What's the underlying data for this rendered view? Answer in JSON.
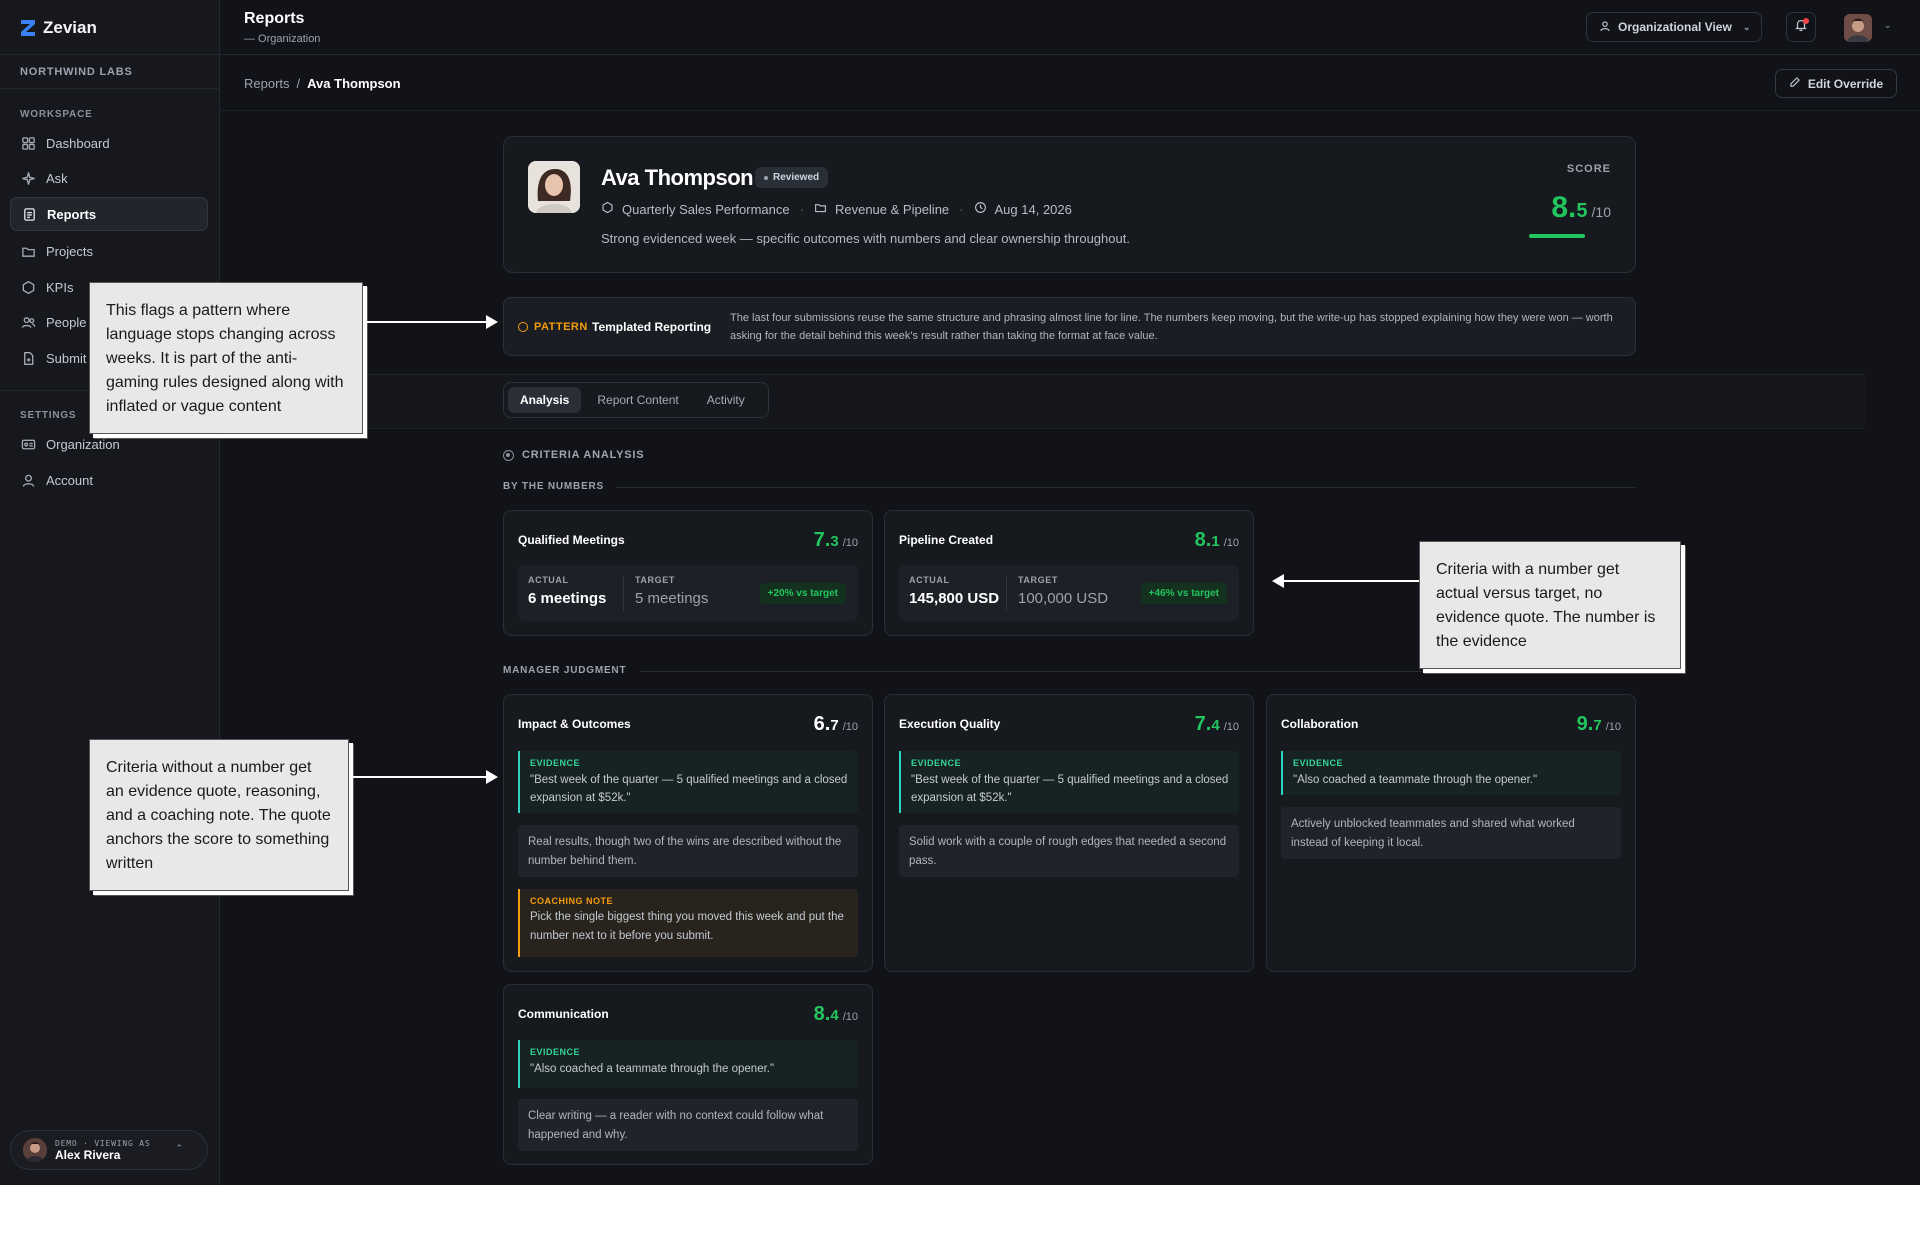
{
  "app": {
    "name": "Zevian",
    "org": "NORTHWIND LABS"
  },
  "sidebar": {
    "workspace_label": "WORKSPACE",
    "settings_label": "SETTINGS",
    "items": [
      {
        "label": "Dashboard",
        "icon": "grid-icon"
      },
      {
        "label": "Ask",
        "icon": "sparkle-icon"
      },
      {
        "label": "Reports",
        "icon": "report-icon"
      },
      {
        "label": "Projects",
        "icon": "folder-icon"
      },
      {
        "label": "KPIs",
        "icon": "hexagon-icon"
      },
      {
        "label": "People",
        "icon": "people-icon"
      },
      {
        "label": "Submit",
        "icon": "file-plus-icon"
      }
    ],
    "settings_items": [
      {
        "label": "Organization",
        "icon": "id-card-icon"
      },
      {
        "label": "Account",
        "icon": "user-icon"
      }
    ],
    "demo": {
      "label": "DEMO · VIEWING AS",
      "name": "Alex Rivera"
    }
  },
  "header": {
    "title": "Reports",
    "subtitle": "— Organization",
    "view_select": "Organizational View"
  },
  "breadcrumb": {
    "root": "Reports",
    "separator": "/",
    "current": "Ava Thompson",
    "edit_label": "Edit Override"
  },
  "profile": {
    "name": "Ava Thompson",
    "badge": "Reviewed",
    "kpi": "Quarterly Sales Performance",
    "project": "Revenue & Pipeline",
    "date": "Aug 14, 2026",
    "summary": "Strong evidenced week — specific outcomes with numbers and clear ownership throughout.",
    "score_label": "SCORE",
    "score_int": "8.",
    "score_dec": "5",
    "score_den": "/10",
    "score_value": 8.5
  },
  "pattern": {
    "tag": "PATTERN",
    "title": "Templated Reporting",
    "text": "The last four submissions reuse the same structure and phrasing almost line for line. The numbers keep moving, but the write-up has stopped explaining how they were won — worth asking for the detail behind this week's result rather than taking the format at face value."
  },
  "tabs": [
    "Analysis",
    "Report Content",
    "Activity"
  ],
  "criteria": {
    "title": "CRITERIA ANALYSIS",
    "numbers_title": "BY THE NUMBERS",
    "judgment_title": "MANAGER JUDGMENT",
    "actual_label": "ACTUAL",
    "target_label": "TARGET",
    "evidence_label": "EVIDENCE",
    "coaching_label": "COACHING NOTE",
    "numbers": [
      {
        "title": "Qualified Meetings",
        "score_int": "7.",
        "score_dec": "3",
        "den": "/10",
        "actual": "6 meetings",
        "target": "5 meetings",
        "delta": "+20% vs target"
      },
      {
        "title": "Pipeline Created",
        "score_int": "8.",
        "score_dec": "1",
        "den": "/10",
        "actual": "145,800 USD",
        "target": "100,000 USD",
        "delta": "+46% vs target"
      }
    ],
    "judgment": [
      {
        "title": "Impact & Outcomes",
        "score_int": "6.",
        "score_dec": "7",
        "den": "/10",
        "evidence": "\"Best week of the quarter — 5 qualified meetings and a closed expansion at $52k.\"",
        "reasoning": "Real results, though two of the wins are described without the number behind them.",
        "coaching": "Pick the single biggest thing you moved this week and put the number next to it before you submit."
      },
      {
        "title": "Execution Quality",
        "score_int": "7.",
        "score_dec": "4",
        "den": "/10",
        "evidence": "\"Best week of the quarter — 5 qualified meetings and a closed expansion at $52k.\"",
        "reasoning": "Solid work with a couple of rough edges that needed a second pass."
      },
      {
        "title": "Collaboration",
        "score_int": "9.",
        "score_dec": "7",
        "den": "/10",
        "evidence": "\"Also coached a teammate through the opener.\"",
        "reasoning": "Actively unblocked teammates and shared what worked instead of keeping it local."
      },
      {
        "title": "Communication",
        "score_int": "8.",
        "score_dec": "4",
        "den": "/10",
        "evidence": "\"Also coached a teammate through the opener.\"",
        "reasoning": "Clear writing — a reader with no context could follow what happened and why."
      }
    ]
  },
  "annotations": {
    "pattern": "This flags a pattern where language stops changing across weeks. It is part of the anti-gaming rules designed along with inflated or vague content",
    "numbers": "Criteria with a number get actual versus target, no evidence quote. The number is the evidence",
    "judgment": "Criteria without a number get an evidence quote, reasoning, and a coaching note. The quote anchors the score to something written"
  },
  "colors": {
    "accent": "#3b82f6",
    "good": "#22c55e",
    "warn": "#f59e0b",
    "evidence": "#2dd4bf",
    "bg": "#111318"
  }
}
